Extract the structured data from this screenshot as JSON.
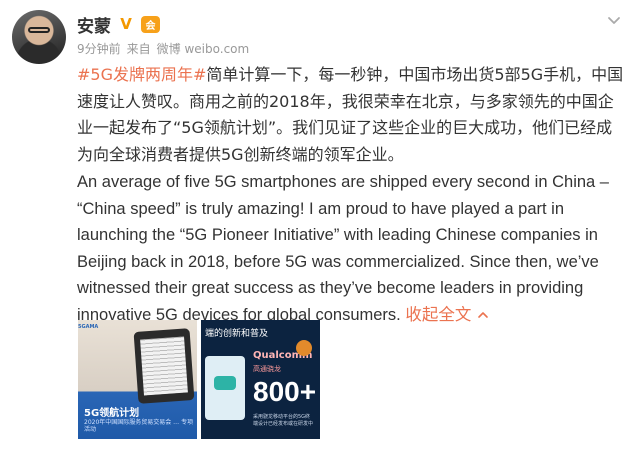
{
  "post": {
    "author": "安蒙",
    "verified_symbol": "V",
    "badge_symbol": "会",
    "time": "9分钟前",
    "source_prefix": "来自",
    "source": "微博 weibo.com",
    "hashtag": "#5G发牌两周年#",
    "text_zh_rest": "简单计算一下，每一秒钟，中国市场出货5部5G手机，中国速度让人赞叹。商用之前的2018年，我很荣幸在北京，与多家领先的中国企业一起发布了“5G领航计划”。我们见证了这些企业的巨大成功，他们已经成为向全球消费者提供5G创新终端的领军企业。",
    "text_en": "An average of five 5G smartphones are shipped every second in China – “China speed” is truly amazing! I am proud to have played a part in launching the “5G Pioneer Initiative” with leading Chinese companies in Beijing back in 2018, before 5G was commercialized. Since then, we’ve witnessed their great success as they’ve become leaders in providing innovative 5G devices for global consumers.",
    "collapse_label": "收起全文",
    "collapse_icon": "chevron-up-icon"
  },
  "header_menu_icon": "chevron-down-icon",
  "images": [
    {
      "tag": "5GAMA",
      "caption": "5G领航计划",
      "sub": "2020年中国国际服务贸易交易会 … 专项活动"
    },
    {
      "title": "端的创新和普及",
      "brand": "Qualcomm",
      "brand_cn": "高通骁龙",
      "big_number": "800+",
      "small_text": "采用骁龙移动平台的5G终端设计已经发布或在研发中"
    }
  ]
}
